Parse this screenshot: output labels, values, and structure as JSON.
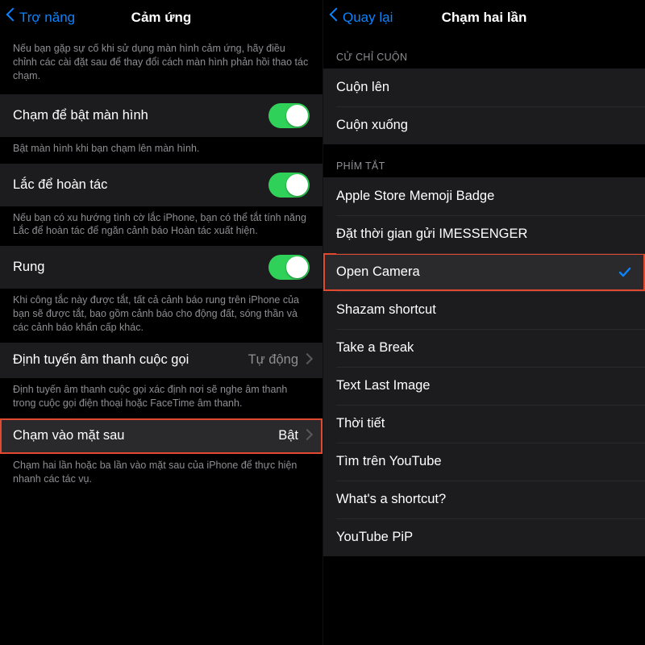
{
  "colors": {
    "accent": "#0a84ff",
    "toggle_on": "#30d158",
    "highlight": "#e2492f"
  },
  "left": {
    "nav": {
      "back": "Trợ năng",
      "title": "Cảm ứng"
    },
    "intro": "Nếu bạn gặp sự cố khi sử dụng màn hình cảm ứng, hãy điều chỉnh các cài đặt sau để thay đổi cách màn hình phản hồi thao tác chạm.",
    "tap_to_wake": {
      "label": "Chạm để bật màn hình",
      "on": true,
      "note": "Bật màn hình khi bạn chạm lên màn hình."
    },
    "shake_undo": {
      "label": "Lắc để hoàn tác",
      "on": true,
      "note": "Nếu bạn có xu hướng tình cờ lắc iPhone, bạn có thể tắt tính năng Lắc để hoàn tác để ngăn cảnh báo Hoàn tác xuất hiện."
    },
    "vibration": {
      "label": "Rung",
      "on": true,
      "note": "Khi công tắc này được tắt, tất cả cảnh báo rung trên iPhone của bạn sẽ được tắt, bao gồm cảnh báo cho động đất, sóng thần và các cảnh báo khẩn cấp khác."
    },
    "audio_routing": {
      "label": "Định tuyến âm thanh cuộc gọi",
      "value": "Tự động",
      "note": "Định tuyến âm thanh cuộc gọi xác định nơi sẽ nghe âm thanh trong cuộc gọi điện thoại hoặc FaceTime âm thanh."
    },
    "back_tap": {
      "label": "Chạm vào mặt sau",
      "value": "Bật",
      "note": "Chạm hai lần hoặc ba lần vào mặt sau của iPhone để thực hiện nhanh các tác vụ."
    }
  },
  "right": {
    "nav": {
      "back": "Quay lại",
      "title": "Chạm hai lần"
    },
    "sections": {
      "scroll": {
        "header": "CỬ CHỈ CUỘN",
        "items": [
          "Cuộn lên",
          "Cuộn xuống"
        ]
      },
      "shortcuts": {
        "header": "PHÍM TẮT",
        "items": [
          "Apple Store Memoji Badge",
          "Đặt thời gian gửi IMESSENGER",
          "Open Camera",
          "Shazam shortcut",
          "Take a Break",
          "Text Last Image",
          "Thời tiết",
          "Tìm trên YouTube",
          "What's a shortcut?",
          "YouTube PiP"
        ],
        "selected_index": 2
      }
    }
  }
}
